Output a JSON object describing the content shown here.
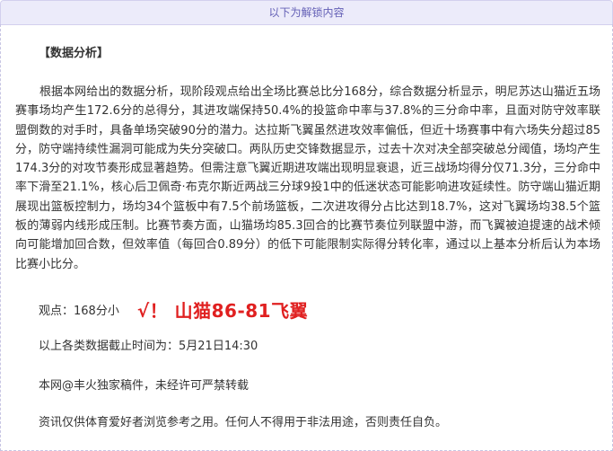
{
  "header": {
    "title": "以下为解锁内容"
  },
  "article": {
    "heading": "【数据分析】",
    "analysis": "根据本网给出的数据分析，现阶段观点给出全场比赛总比分168分，综合数据分析显示，明尼苏达山猫近五场赛事场均产生172.6分的总得分，其进攻端保持50.4%的投篮命中率与37.8%的三分命中率，且面对防守效率联盟倒数的对手时，具备单场突破90分的潜力。达拉斯飞翼虽然进攻效率偏低，但近十场赛事中有六场失分超过85分，防守端持续性漏洞可能成为失分突破口。两队历史交锋数据显示，过去十次对决全部突破总分阈值，场均产生174.3分的对攻节奏形成显著趋势。但需注意飞翼近期进攻端出现明显衰退，近三战场均得分仅71.3分，三分命中率下滑至21.1%，核心后卫佩奇·布克尔斯近两战三分球9投1中的低迷状态可能影响进攻延续性。防守端山猫近期展现出篮板控制力，场均34个篮板中有7.5个前场篮板，二次进攻得分占比达到18.7%，这对飞翼场均38.5个篮板的薄弱内线形成压制。比赛节奏方面，山猫场均85.3回合的比赛节奏位列联盟中游，而飞翼被迫提速的战术倾向可能增加回合数，但效率值（每回合0.89分）的低下可能限制实际得分转化率，通过以上基本分析后认为本场比赛小比分。",
    "opinion_label": "观点：168分小",
    "result": "√！ 山猫86-81飞翼",
    "data_cutoff": "以上各类数据截止时间为：5月21日14:30",
    "copyright": "本网@丰火独家稿件，未经许可严禁转载",
    "disclaimer": "资讯仅供体育爱好者浏览参考之用。任何人不得用于非法用途，否则责任自负。"
  },
  "colors": {
    "header_bg": "#ecebfa",
    "header_text": "#6460b6",
    "result_red": "#e02020",
    "body_text": "#333333"
  }
}
